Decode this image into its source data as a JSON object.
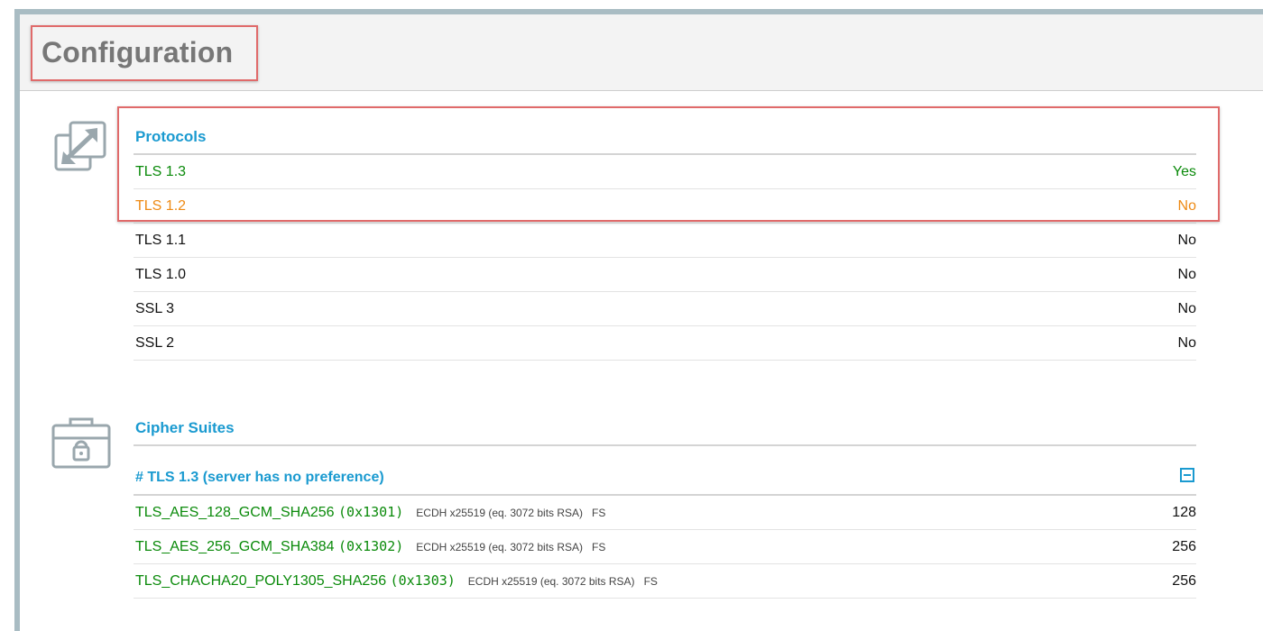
{
  "page": {
    "title": "Configuration"
  },
  "protocols": {
    "title": "Protocols",
    "icon": "resize-arrows-icon",
    "rows": [
      {
        "name": "TLS 1.3",
        "value": "Yes",
        "status": "green"
      },
      {
        "name": "TLS 1.2",
        "value": "No",
        "status": "orange"
      },
      {
        "name": "TLS 1.1",
        "value": "No",
        "status": "normal"
      },
      {
        "name": "TLS 1.0",
        "value": "No",
        "status": "normal"
      },
      {
        "name": "SSL 3",
        "value": "No",
        "status": "normal"
      },
      {
        "name": "SSL 2",
        "value": "No",
        "status": "normal"
      }
    ]
  },
  "cipher_suites": {
    "title": "Cipher Suites",
    "icon": "lock-briefcase-icon",
    "group_title": "# TLS 1.3 (server has no preference)",
    "rows": [
      {
        "name": "TLS_AES_128_GCM_SHA256",
        "code": "(0x1301)",
        "details": "ECDH x25519 (eq. 3072 bits RSA)",
        "fs": "FS",
        "bits": "128"
      },
      {
        "name": "TLS_AES_256_GCM_SHA384",
        "code": "(0x1302)",
        "details": "ECDH x25519 (eq. 3072 bits RSA)",
        "fs": "FS",
        "bits": "256"
      },
      {
        "name": "TLS_CHACHA20_POLY1305_SHA256",
        "code": "(0x1303)",
        "details": "ECDH x25519 (eq. 3072 bits RSA)",
        "fs": "FS",
        "bits": "256"
      }
    ]
  },
  "colors": {
    "accent": "#1a9ad0",
    "ok": "#0a8a0a",
    "warn": "#ee8a14",
    "highlight": "#e06a6a",
    "frame": "#a9bcc3"
  }
}
